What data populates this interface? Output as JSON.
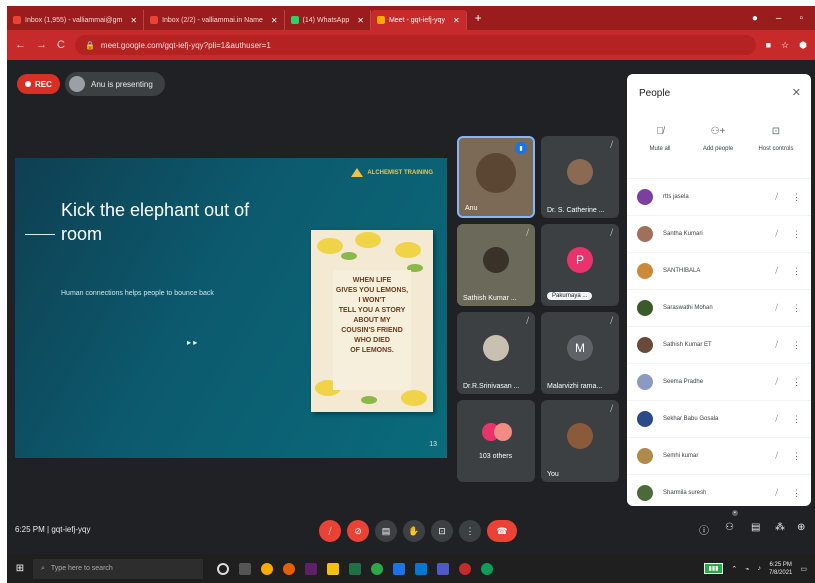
{
  "tabs": [
    {
      "label": "Inbox (1,955) - valliammai@gm",
      "color": "#ea4335"
    },
    {
      "label": "Inbox (2/2) - valliammai.in Name",
      "color": "#ea4335"
    },
    {
      "label": "(14) WhatsApp",
      "color": "#25d366"
    },
    {
      "label": "Meet - gqt-iefj-yqy",
      "color": "#f9ab00"
    }
  ],
  "new_tab": "+",
  "address": {
    "url": "meet.google.com/gqt-iefj-yqy?pli=1&authuser=1",
    "back": "←",
    "forward": "→",
    "reload": "C",
    "lock": "🔒"
  },
  "meet": {
    "rec_label": "REC",
    "presenting": "Anu is presenting",
    "time_code": "6:25 PM",
    "meeting_code": "gqt-iefj-yqy"
  },
  "slide": {
    "brand": "ALCHEMIST TRAINING",
    "title": "Kick the elephant out of room",
    "subtitle": "Human connections helps people to bounce back",
    "page": "13",
    "card_lines": [
      "WHEN LIFE",
      "GIVES YOU LEMONS,",
      "I WON'T",
      "TELL YOU A STORY",
      "ABOUT MY",
      "COUSIN'S FRIEND",
      "WHO DIED",
      "OF LEMONS."
    ]
  },
  "tiles": [
    {
      "name": "Anu",
      "kind": "video"
    },
    {
      "name": "Dr. S. Catherine ...",
      "kind": "video"
    },
    {
      "name": "Sathish Kumar ...",
      "kind": "video"
    },
    {
      "name": "P",
      "kind": "letter",
      "chip": "Pakurnaya ..."
    },
    {
      "name": "Dr.R.Srinivasan ...",
      "kind": "video"
    },
    {
      "name": "Malarvizhi rama...",
      "kind": "letter",
      "letter": "M"
    },
    {
      "name": "103 others",
      "kind": "group"
    },
    {
      "name": "You",
      "kind": "video"
    }
  ],
  "people": {
    "title": "People",
    "close": "✕",
    "actions": [
      {
        "label": "Mute all",
        "icon": "mic-off-icon"
      },
      {
        "label": "Add people",
        "icon": "add-person-icon"
      },
      {
        "label": "Host controls",
        "icon": "host-controls-icon"
      }
    ],
    "list": [
      {
        "name": "rtts jasela",
        "color": "#7b3fa0"
      },
      {
        "name": "Santha Kumari",
        "color": "#a0705a"
      },
      {
        "name": "SANTHIBALA",
        "color": "#c98a3a"
      },
      {
        "name": "Saraswathi Mohan",
        "color": "#3b5a2a"
      },
      {
        "name": "Sathish Kumar ET",
        "color": "#6a4a3a"
      },
      {
        "name": "Seema Pradhe",
        "color": "#8a9ac0"
      },
      {
        "name": "Sekhar Babu Gosala",
        "color": "#2a4a8a"
      },
      {
        "name": "Semhi kumar",
        "color": "#b08a4a"
      },
      {
        "name": "Sharmila suresh",
        "color": "#4a6a3a"
      }
    ]
  },
  "taskbar": {
    "search": "Type here to search",
    "time": "6:25 PM",
    "date": "7/8/2021"
  }
}
